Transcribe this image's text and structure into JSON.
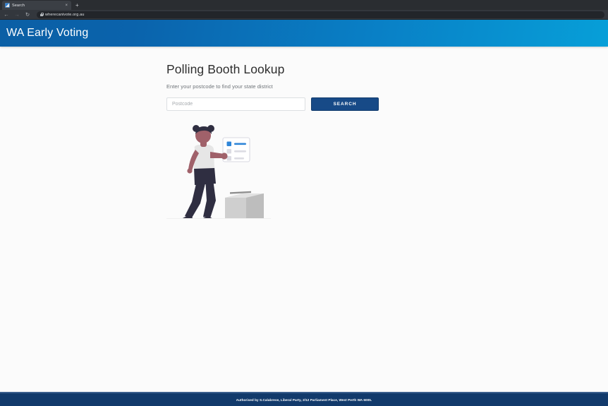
{
  "browser": {
    "tab": {
      "title": "Search",
      "favicon_icon": "site-favicon",
      "close_icon": "×"
    },
    "new_tab_icon": "+",
    "nav": {
      "back_icon": "←",
      "forward_icon": "→",
      "reload_icon": "↻"
    },
    "omnibox": {
      "lock_icon": "lock-icon",
      "url": "wherecanivote.org.au"
    }
  },
  "site": {
    "header": {
      "title": "WA Early Voting",
      "gradient_from": "#0b5fa5",
      "gradient_to": "#079fd8"
    },
    "main": {
      "title": "Polling Booth Lookup",
      "subtitle": "Enter your postcode to find your state district",
      "postcode_placeholder": "Postcode",
      "postcode_value": "",
      "search_label": "SEARCH",
      "search_button_color": "#174a87",
      "illustration_name": "voter-with-ballot-and-ballot-box"
    },
    "footer": {
      "text": "Authorised by S.Calabrese, Liberal Party, 2/12 Parliament Place, West Perth WA 6005.",
      "background": "#123a6b"
    }
  }
}
